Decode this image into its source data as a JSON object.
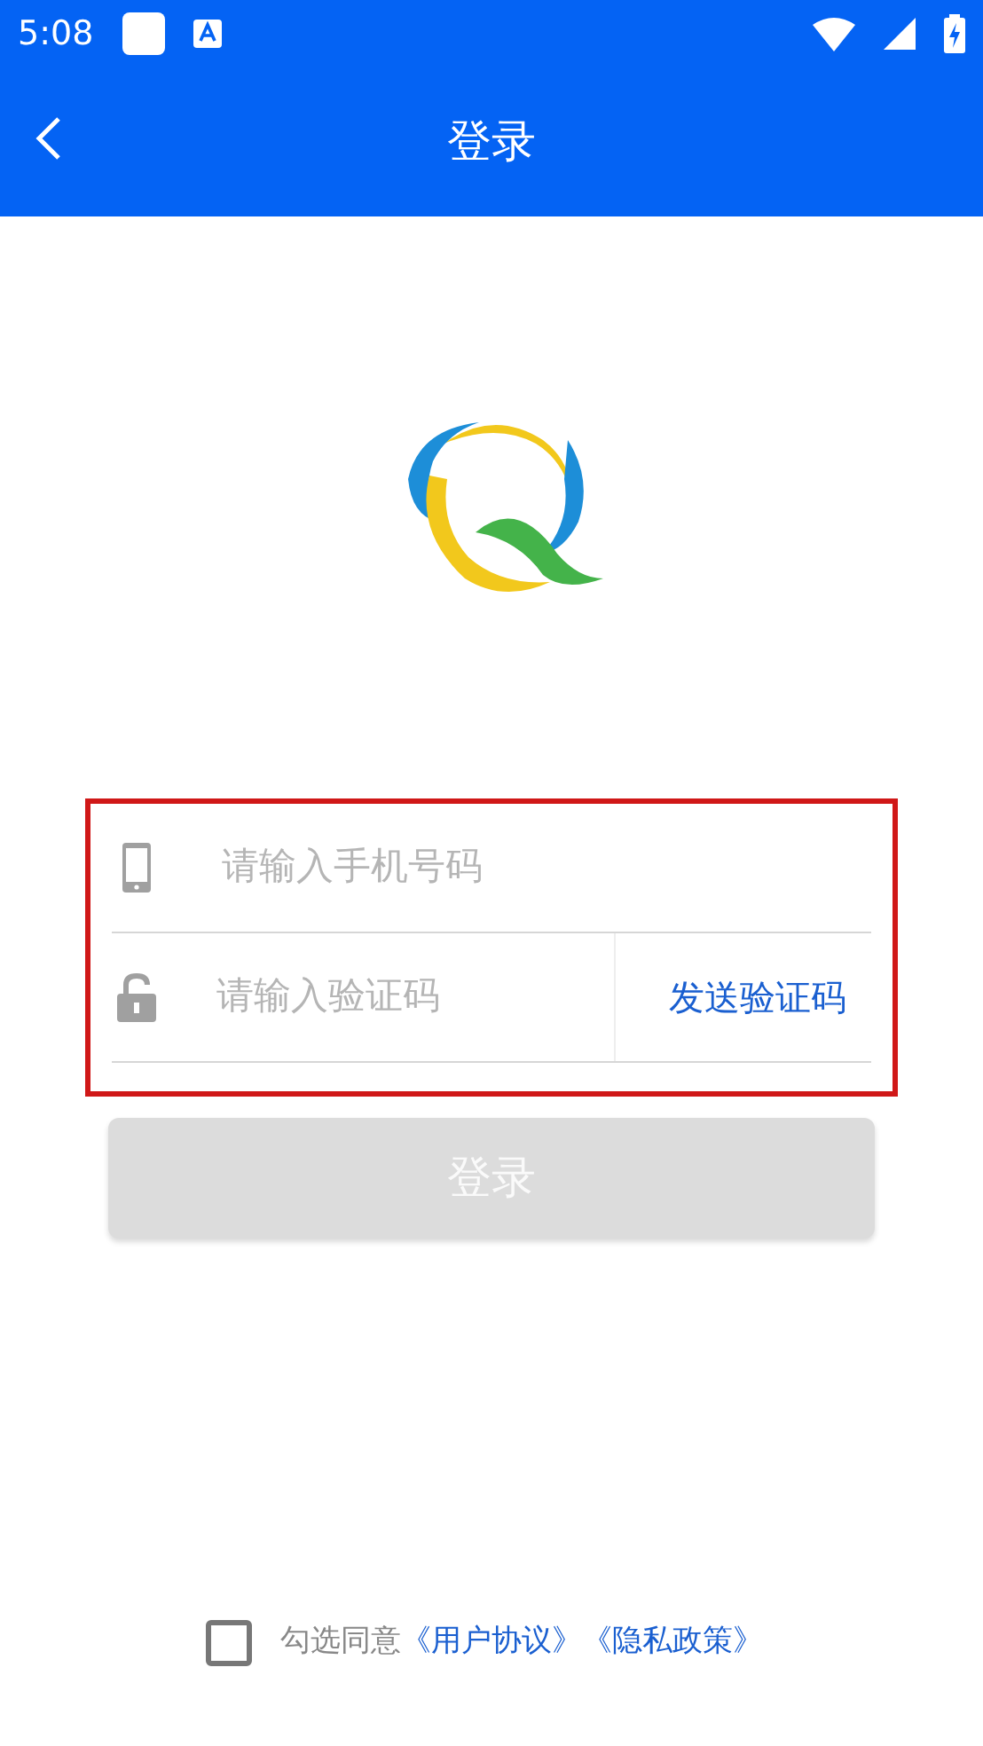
{
  "status_bar": {
    "time": "5:08"
  },
  "header": {
    "title": "登录"
  },
  "form": {
    "highlighted": true,
    "phone_field": {
      "placeholder": "请输入手机号码"
    },
    "code_field": {
      "placeholder": "请输入验证码"
    },
    "send_code": "发送验证码"
  },
  "login_button": {
    "label": "登录",
    "disabled": true
  },
  "agreement": {
    "checked": false,
    "text": "勾选同意",
    "links": [
      "《用户协议》",
      "《隐私政策》"
    ]
  }
}
